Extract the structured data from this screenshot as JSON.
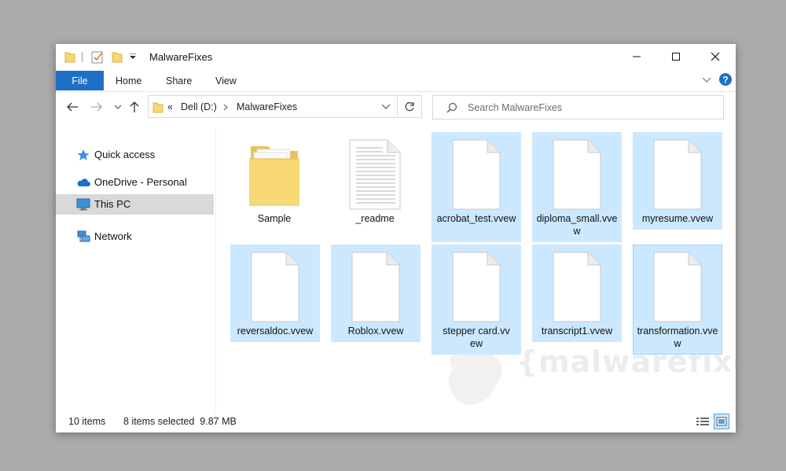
{
  "window": {
    "title": "MalwareFixes"
  },
  "ribbon": {
    "tabs": [
      "File",
      "Home",
      "Share",
      "View"
    ]
  },
  "address": {
    "overflow": "«",
    "segments": [
      "Dell (D:)",
      "MalwareFixes"
    ]
  },
  "search": {
    "placeholder": "Search MalwareFixes"
  },
  "nav": {
    "items": [
      "Quick access",
      "OneDrive - Personal",
      "This PC",
      "Network"
    ],
    "selected": "This PC"
  },
  "files": [
    {
      "name": "Sample",
      "type": "folder",
      "selected": false
    },
    {
      "name": "_readme",
      "type": "text",
      "selected": false
    },
    {
      "name": "acrobat_test.vvew",
      "type": "blank",
      "selected": true
    },
    {
      "name": "diploma_small.vvew",
      "type": "blank",
      "selected": true
    },
    {
      "name": "myresume.vvew",
      "type": "blank",
      "selected": true
    },
    {
      "name": "reversaldoc.vvew",
      "type": "blank",
      "selected": true
    },
    {
      "name": "Roblox.vvew",
      "type": "blank",
      "selected": true
    },
    {
      "name": "stepper card.vvew",
      "type": "blank",
      "selected": true
    },
    {
      "name": "transcript1.vvew",
      "type": "blank",
      "selected": true
    },
    {
      "name": "transformation.vvew",
      "type": "blank",
      "selected": true,
      "focused": true
    }
  ],
  "status": {
    "item_count": "10 items",
    "selection": "8 items selected  9.87 MB"
  },
  "watermark": {
    "text": "{malwarefixes}"
  },
  "colors": {
    "accent": "#1f6fc7",
    "selection": "#cce8ff",
    "nav_selected": "#d9d9d9",
    "backdrop": "#ababab"
  },
  "icons": [
    "folder-icon",
    "checklist-icon",
    "dropdown-icon",
    "minimize-icon",
    "maximize-icon",
    "close-icon",
    "chevron-down-icon",
    "help-icon",
    "back-arrow-icon",
    "forward-arrow-icon",
    "up-arrow-icon",
    "refresh-icon",
    "search-icon",
    "star-icon",
    "cloud-icon",
    "computer-icon",
    "network-icon",
    "details-view-icon",
    "large-icons-view-icon"
  ]
}
